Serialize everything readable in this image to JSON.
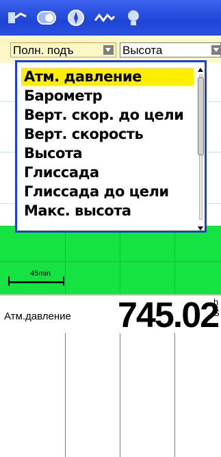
{
  "fields": {
    "left_label": "Полн. подъ",
    "right_label": "Высота"
  },
  "dropdown": {
    "items": [
      "Атм. давление",
      "Барометр",
      "Верт. скор. до цели",
      "Верт. скорость",
      "Высота",
      "Глиссада",
      "Глиссада до цели",
      "Макс. высота"
    ],
    "selected": "Атм. давление"
  },
  "graph": {
    "scale_label": "45min"
  },
  "readout": {
    "label": "Атм.давление",
    "value": "745.02",
    "unit_top": "h",
    "unit_bottom": "S"
  },
  "colors": {
    "topbar": "#1f45d8",
    "selection": "#ffee00",
    "graph_fill": "#15e342",
    "field_bar": "#fbf7c7"
  },
  "icons": [
    "track-icon",
    "toggle-icon",
    "compass-icon",
    "profile-icon",
    "light-icon"
  ]
}
